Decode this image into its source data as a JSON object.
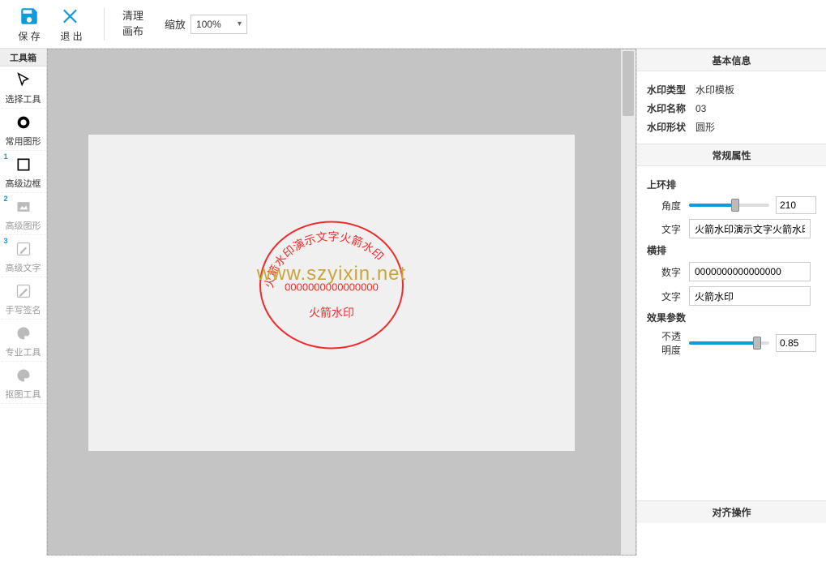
{
  "toolbar": {
    "save_label": "保 存",
    "exit_label": "退 出",
    "clear_label": "清理\n画布",
    "zoom_label": "缩放",
    "zoom_value": "100%"
  },
  "toolbox": {
    "header": "工具箱",
    "items": [
      {
        "label": "选择工具",
        "icon": "cursor",
        "badge": ""
      },
      {
        "label": "常用图形",
        "icon": "circle",
        "badge": ""
      },
      {
        "label": "高级边框",
        "icon": "square",
        "badge": "1"
      },
      {
        "label": "高级图形",
        "icon": "image",
        "badge": "2"
      },
      {
        "label": "高级文字",
        "icon": "edit",
        "badge": "3"
      },
      {
        "label": "手写签名",
        "icon": "pen",
        "badge": ""
      },
      {
        "label": "专业工具",
        "icon": "palette",
        "badge": ""
      },
      {
        "label": "抠图工具",
        "icon": "palette",
        "badge": ""
      }
    ]
  },
  "canvas": {
    "stamp_arc_text": "火箭水印演示文字火箭水印",
    "stamp_digits": "0000000000000000",
    "stamp_bottom": "火箭水印",
    "watermark": "www.szyixin.net"
  },
  "props": {
    "basic_header": "基本信息",
    "type_label": "水印类型",
    "type_value": "水印模板",
    "name_label": "水印名称",
    "name_value": "03",
    "shape_label": "水印形状",
    "shape_value": "圆形",
    "common_header": "常规属性",
    "upper_ring_label": "上环排",
    "angle_label": "角度",
    "angle_value": "210",
    "upper_text_label": "文字",
    "upper_text_value": "火箭水印演示文字火箭水印",
    "horizontal_label": "横排",
    "digit_label": "数字",
    "digit_value": "0000000000000000",
    "hz_text_label": "文字",
    "hz_text_value": "火箭水印",
    "effect_header": "效果参数",
    "opacity_label": "不透明度",
    "opacity_value": "0.85",
    "align_header": "对齐操作"
  },
  "colors": {
    "primary": "#0d9bdb",
    "stamp": "#ef2b2b",
    "watermark": "#c9a63a"
  }
}
